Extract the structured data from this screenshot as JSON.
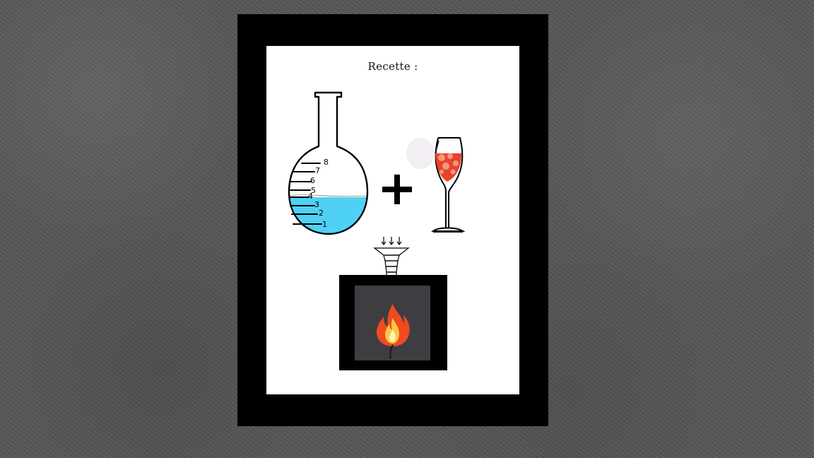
{
  "poster": {
    "title": "Recette :",
    "flask_scale": [
      "1",
      "2",
      "3",
      "4",
      "5",
      "6",
      "7",
      "8"
    ],
    "flask_fill_level": 4
  },
  "colors": {
    "wall": "#5a5a5a",
    "frame": "#000000",
    "paper": "#ffffff",
    "liquid": "#4fd1f5",
    "wine": "#e8432b",
    "furnace_chamber": "#3e3d42",
    "flame_outer": "#f04a1e",
    "flame_inner": "#f7c948"
  },
  "icons": [
    "round-bottom-flask-icon",
    "plus-icon",
    "wine-glass-icon",
    "funnel-icon",
    "furnace-icon",
    "fire-icon"
  ]
}
